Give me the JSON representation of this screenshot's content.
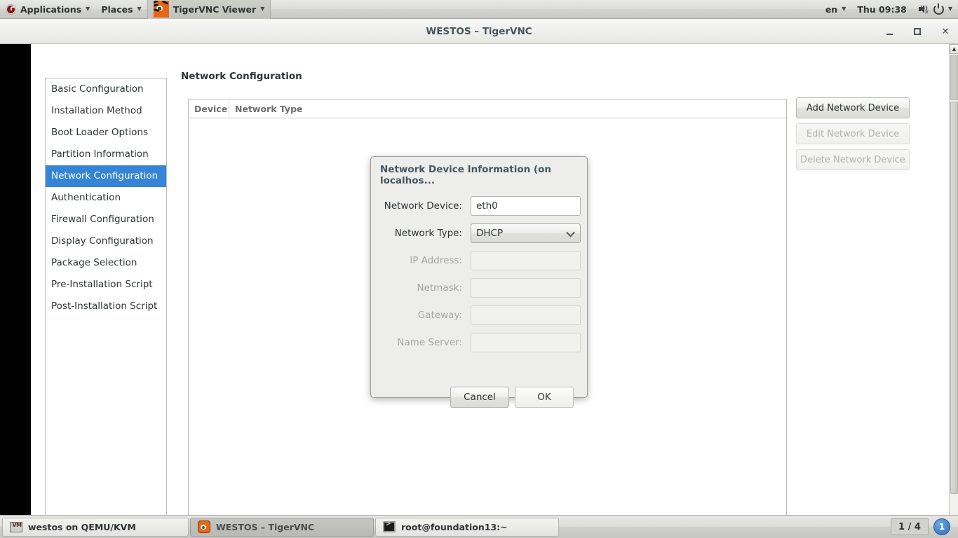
{
  "top_panel": {
    "applications_label": "Applications",
    "places_label": "Places",
    "active_app_label": "TigerVNC Viewer",
    "keyboard_layout": "en",
    "clock": "Thu 09:38",
    "icons": {
      "menu_logo": "fedora-logo-icon",
      "app_icon": "tigervnc-icon",
      "volume": "volume-muted-icon",
      "power": "power-icon"
    }
  },
  "vnc_window": {
    "title": "WESTOS – TigerVNC",
    "buttons": {
      "minimize": "minimize-icon",
      "maximize": "maximize-icon",
      "close": "close-icon"
    }
  },
  "app": {
    "sidebar": {
      "items": [
        {
          "label": "Basic Configuration",
          "selected": false
        },
        {
          "label": "Installation Method",
          "selected": false
        },
        {
          "label": "Boot Loader Options",
          "selected": false
        },
        {
          "label": "Partition Information",
          "selected": false
        },
        {
          "label": "Network Configuration",
          "selected": true
        },
        {
          "label": "Authentication",
          "selected": false
        },
        {
          "label": "Firewall Configuration",
          "selected": false
        },
        {
          "label": "Display Configuration",
          "selected": false
        },
        {
          "label": "Package Selection",
          "selected": false
        },
        {
          "label": "Pre-Installation Script",
          "selected": false
        },
        {
          "label": "Post-Installation Script",
          "selected": false
        }
      ]
    },
    "content_title": "Network Configuration",
    "table": {
      "columns": [
        "Device",
        "Network Type"
      ],
      "rows": []
    },
    "action_buttons": [
      {
        "label": "Add Network Device",
        "enabled": true
      },
      {
        "label": "Edit Network Device",
        "enabled": false
      },
      {
        "label": "Delete Network Device",
        "enabled": false
      }
    ]
  },
  "dialog": {
    "title": "Network Device Information (on localhos...",
    "fields": [
      {
        "label": "Network Device:",
        "value": "eth0",
        "type": "text",
        "enabled": true
      },
      {
        "label": "Network Type:",
        "value": "DHCP",
        "type": "combo",
        "enabled": true
      },
      {
        "label": "IP Address:",
        "value": "",
        "type": "text",
        "enabled": false
      },
      {
        "label": "Netmask:",
        "value": "",
        "type": "text",
        "enabled": false
      },
      {
        "label": "Gateway:",
        "value": "",
        "type": "text",
        "enabled": false
      },
      {
        "label": "Name Server:",
        "value": "",
        "type": "text",
        "enabled": false
      }
    ],
    "cancel_label": "Cancel",
    "ok_label": "OK"
  },
  "bottom_panel": {
    "tasks": [
      {
        "label": "westos on QEMU/KVM",
        "icon": "qemu-icon",
        "active": false
      },
      {
        "label": "WESTOS – TigerVNC",
        "icon": "tigervnc-icon",
        "active": true
      },
      {
        "label": "root@foundation13:~",
        "icon": "terminal-icon",
        "active": false
      }
    ],
    "workspace_indicator": "1 / 4",
    "notification_count": "1"
  },
  "colors": {
    "selection_blue": "#3584d6",
    "panel_grey": "#dcdcd8",
    "dialog_grey": "#ededeb",
    "framebuffer_black": "#000000"
  }
}
